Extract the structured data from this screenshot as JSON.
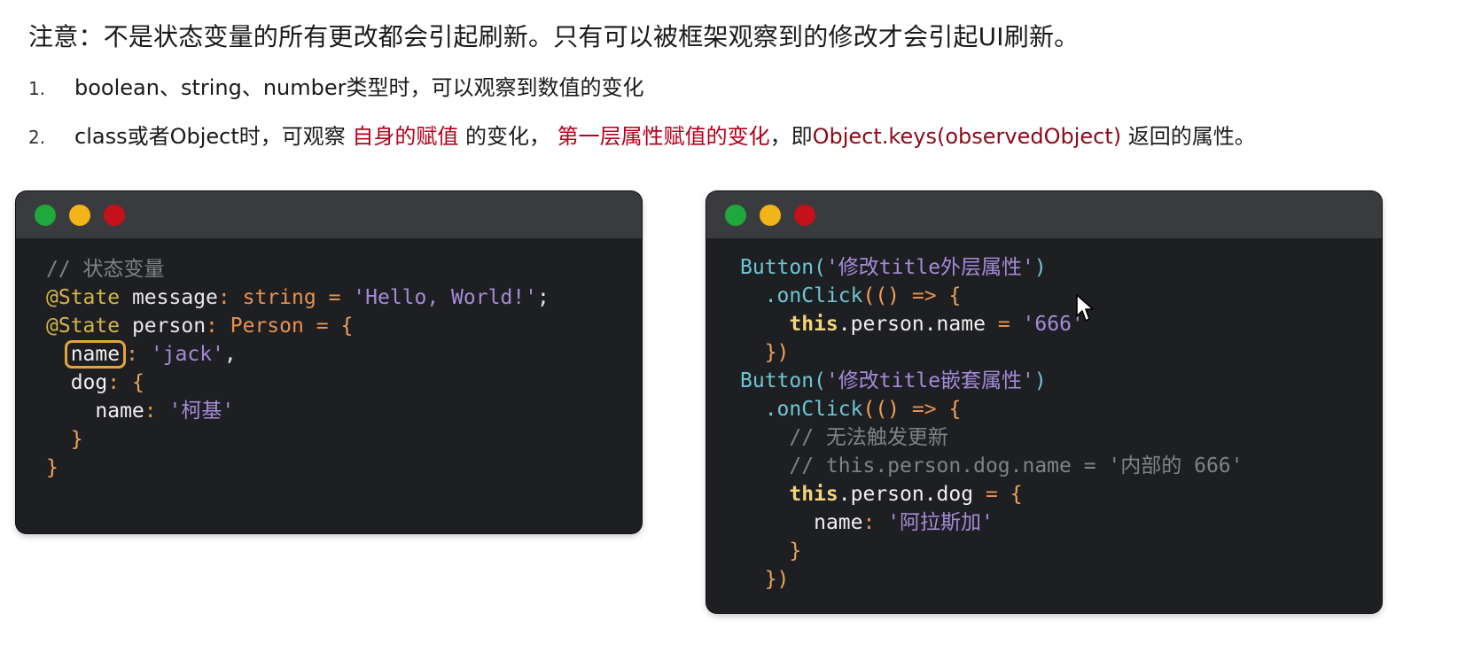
{
  "notice": "注意：不是状态变量的所有更改都会引起刷新。只有可以被框架观察到的修改才会引起UI刷新。",
  "items": [
    {
      "num": "1.",
      "text": "boolean、string、number类型时，可以观察到数值的变化"
    },
    {
      "num": "2.",
      "part1": "class或者Object时，可观察 ",
      "hl1": "自身的赋值",
      "part2": " 的变化， ",
      "hl2": "第一层属性赋值的变化",
      "part3": "，即",
      "hl3": "Object.keys(observedObject)",
      "part4": " 返回的属性。"
    }
  ],
  "left_code": {
    "comment": "// 状态变量",
    "deco1": "@State",
    "var1": "message",
    "type1": "string",
    "val1": "'Hello, World!'",
    "deco2": "@State",
    "var2": "person",
    "type2": "Person",
    "name_key": "name",
    "name_val": "'jack'",
    "dog_key": "dog",
    "dog_name_key": "name",
    "dog_name_val": "'柯基'"
  },
  "right_code": {
    "btn1_fn": "Button",
    "btn1_label": "'修改title外层属性'",
    "onclick1": ".onClick",
    "this1": "this",
    "assign1_path": ".person.name",
    "assign1_val": "'666'",
    "btn2_fn": "Button",
    "btn2_label": "'修改title嵌套属性'",
    "onclick2": ".onClick",
    "comment1": "// 无法触发更新",
    "comment2": "// this.person.dog.name = '内部的 666'",
    "this2": "this",
    "assign2_path": ".person.dog",
    "inner_name_key": "name",
    "inner_name_val": "'阿拉斯加'"
  },
  "colors": {
    "highlight": "#b3001b",
    "code_bg": "#1e1f22",
    "titlebar": "#3a3b3e",
    "dot_green": "#1fa83c",
    "dot_yellow": "#f2b418",
    "dot_red": "#c4111a"
  }
}
